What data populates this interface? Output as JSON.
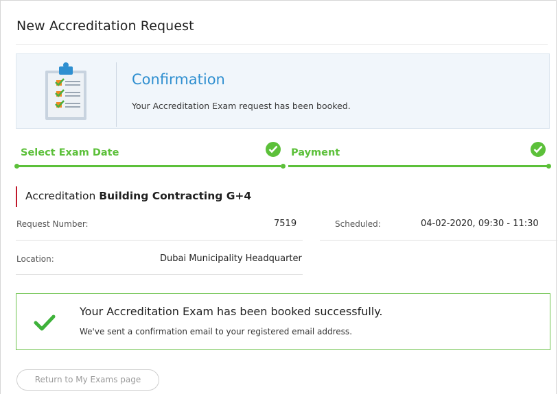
{
  "page": {
    "title": "New Accreditation Request"
  },
  "confirmation": {
    "heading": "Confirmation",
    "text": "Your Accreditation Exam request has been booked.",
    "icon": "clipboard-checklist-icon"
  },
  "steps": [
    {
      "label": "Select Exam Date",
      "status": "complete"
    },
    {
      "label": "Payment",
      "status": "complete"
    }
  ],
  "accreditation": {
    "prefix": "Accreditation",
    "name": "Building Contracting G+4"
  },
  "details": {
    "request_number_label": "Request Number:",
    "request_number_value": "7519",
    "scheduled_label": "Scheduled:",
    "scheduled_value": "04-02-2020, 09:30 - 11:30",
    "location_label": "Location:",
    "location_value": "Dubai Municipality Headquarter"
  },
  "success": {
    "title": "Your Accreditation Exam has been booked successfully.",
    "subtitle": "We've sent a confirmation email to your registered email address."
  },
  "actions": {
    "return_label": "Return to My Exams page"
  },
  "colors": {
    "accent_green": "#5cc03a",
    "accent_blue": "#2f8fd0",
    "accent_red": "#c0182b"
  }
}
